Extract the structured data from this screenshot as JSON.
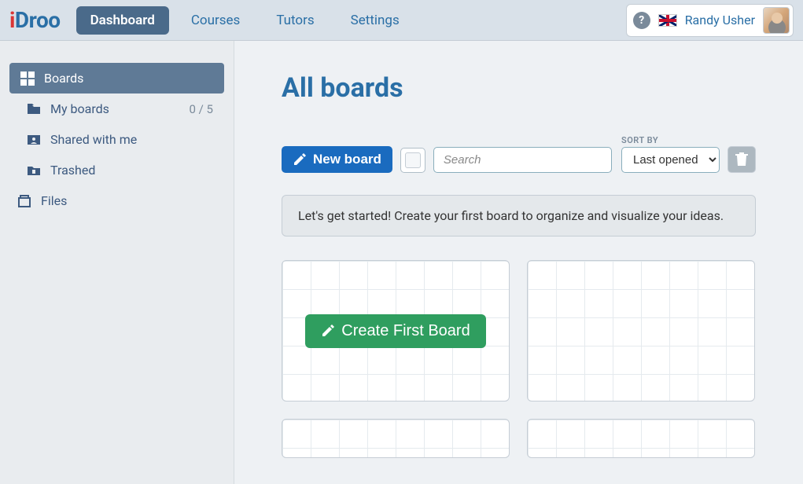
{
  "brand": {
    "i": "i",
    "rest": "Droo"
  },
  "nav": {
    "dashboard": "Dashboard",
    "courses": "Courses",
    "tutors": "Tutors",
    "settings": "Settings"
  },
  "user": {
    "name": "Randy Usher",
    "help_symbol": "?"
  },
  "sidebar": {
    "boards": "Boards",
    "my_boards": "My boards",
    "my_boards_count": "0 / 5",
    "shared": "Shared with me",
    "trashed": "Trashed",
    "files": "Files"
  },
  "page": {
    "title": "All boards",
    "new_board": "New board",
    "search_placeholder": "Search",
    "sort_by_label": "SORT BY",
    "sort_value": "Last opened",
    "banner": "Let's get started! Create your first board to organize and visualize your ideas.",
    "create_first": "Create First Board"
  }
}
